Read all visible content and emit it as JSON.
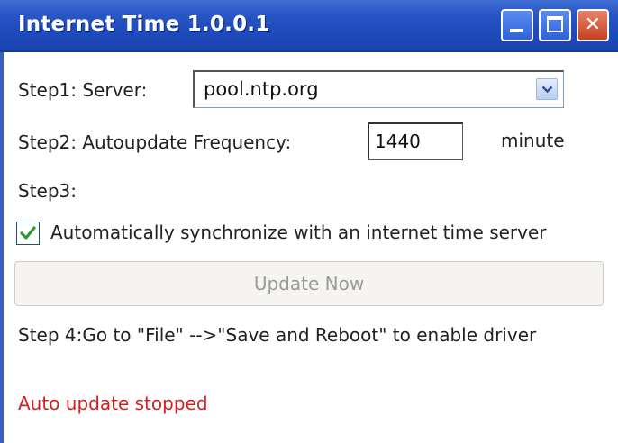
{
  "window": {
    "title": "Internet Time 1.0.0.1"
  },
  "step1": {
    "label": "Step1: Server:",
    "server_value": "pool.ntp.org"
  },
  "step2": {
    "label": "Step2: Autoupdate Frequency:",
    "frequency_value": "1440",
    "unit": "minute"
  },
  "step3": {
    "label": "Step3:",
    "checkbox_label": "Automatically synchronize with an internet time server",
    "checkbox_checked": true
  },
  "update_button": {
    "label": "Update Now",
    "enabled": false
  },
  "step4": {
    "text": "Step 4:Go to \"File\" -->\"Save and Reboot\" to enable driver"
  },
  "status": {
    "text": "Auto update stopped",
    "color": "#d42020"
  },
  "colors": {
    "titlebar": "#2a58c8",
    "close_button": "#c5401f",
    "checkmark": "#2e9a2e"
  },
  "icons": {
    "minimize": "minimize-icon",
    "maximize": "maximize-icon",
    "close": "close-icon",
    "dropdown": "chevron-down-icon",
    "check": "checkmark-icon"
  }
}
